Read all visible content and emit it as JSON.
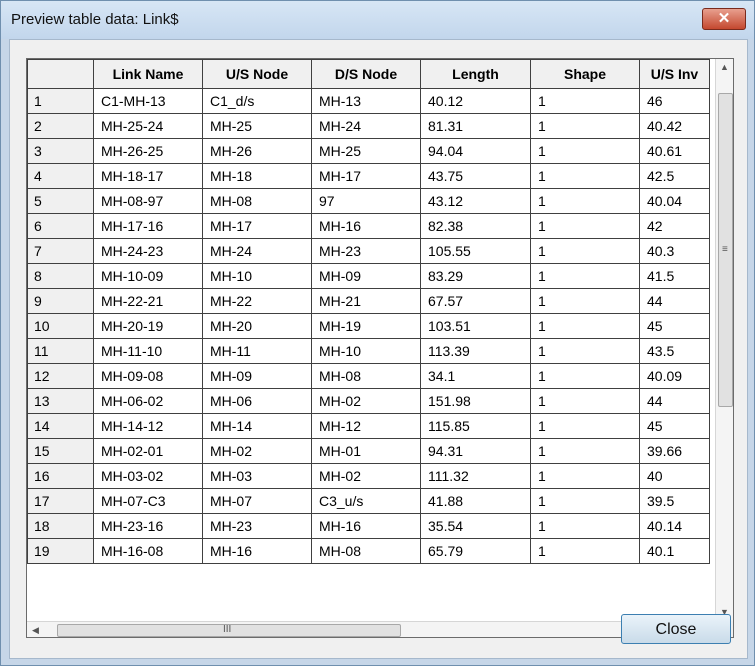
{
  "window": {
    "title": "Preview table data: Link$",
    "close_glyph": "✕"
  },
  "table": {
    "columns": [
      "",
      "Link Name",
      "U/S Node",
      "D/S Node",
      "Length",
      "Shape",
      "U/S Inv"
    ],
    "rows": [
      [
        "1",
        "C1-MH-13",
        "C1_d/s",
        "MH-13",
        "40.12",
        "1",
        "46"
      ],
      [
        "2",
        "MH-25-24",
        "MH-25",
        "MH-24",
        "81.31",
        "1",
        "40.42"
      ],
      [
        "3",
        "MH-26-25",
        "MH-26",
        "MH-25",
        "94.04",
        "1",
        "40.61"
      ],
      [
        "4",
        "MH-18-17",
        "MH-18",
        "MH-17",
        "43.75",
        "1",
        "42.5"
      ],
      [
        "5",
        "MH-08-97",
        "MH-08",
        "97",
        "43.12",
        "1",
        "40.04"
      ],
      [
        "6",
        "MH-17-16",
        "MH-17",
        "MH-16",
        "82.38",
        "1",
        "42"
      ],
      [
        "7",
        "MH-24-23",
        "MH-24",
        "MH-23",
        "105.55",
        "1",
        "40.3"
      ],
      [
        "8",
        "MH-10-09",
        "MH-10",
        "MH-09",
        "83.29",
        "1",
        "41.5"
      ],
      [
        "9",
        "MH-22-21",
        "MH-22",
        "MH-21",
        "67.57",
        "1",
        "44"
      ],
      [
        "10",
        "MH-20-19",
        "MH-20",
        "MH-19",
        "103.51",
        "1",
        "45"
      ],
      [
        "11",
        "MH-11-10",
        "MH-11",
        "MH-10",
        "113.39",
        "1",
        "43.5"
      ],
      [
        "12",
        "MH-09-08",
        "MH-09",
        "MH-08",
        "34.1",
        "1",
        "40.09"
      ],
      [
        "13",
        "MH-06-02",
        "MH-06",
        "MH-02",
        "151.98",
        "1",
        "44"
      ],
      [
        "14",
        "MH-14-12",
        "MH-14",
        "MH-12",
        "115.85",
        "1",
        "45"
      ],
      [
        "15",
        "MH-02-01",
        "MH-02",
        "MH-01",
        "94.31",
        "1",
        "39.66"
      ],
      [
        "16",
        "MH-03-02",
        "MH-03",
        "MH-02",
        "111.32",
        "1",
        "40"
      ],
      [
        "17",
        "MH-07-C3",
        "MH-07",
        "C3_u/s",
        "41.88",
        "1",
        "39.5"
      ],
      [
        "18",
        "MH-23-16",
        "MH-23",
        "MH-16",
        "35.54",
        "1",
        "40.14"
      ],
      [
        "19",
        "MH-16-08",
        "MH-16",
        "MH-08",
        "65.79",
        "1",
        "40.1"
      ]
    ]
  },
  "scroll": {
    "up_arrow": "▲",
    "down_arrow": "▼",
    "left_arrow": "◀",
    "right_arrow": "▶",
    "v_grip": "≡",
    "h_grip": "III",
    "vertical_position": 0.0,
    "horizontal_position": 0.0
  },
  "footer": {
    "close_label": "Close"
  },
  "icons": {
    "window_close": "close-icon"
  }
}
